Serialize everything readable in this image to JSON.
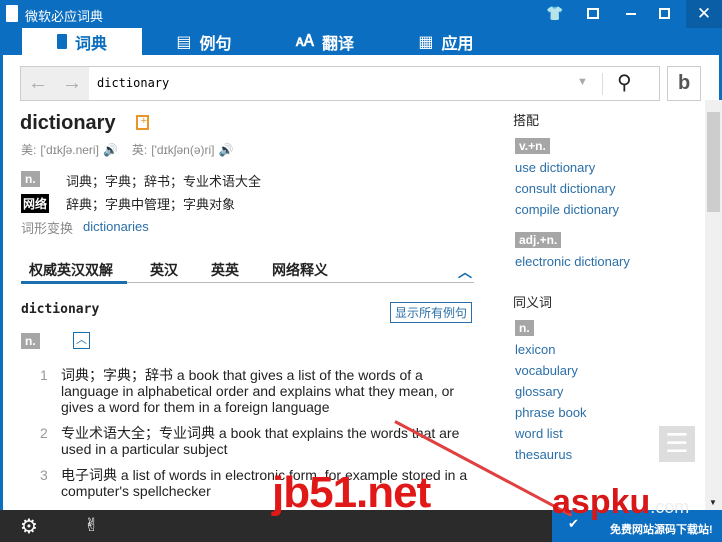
{
  "window": {
    "title": "微软必应词典",
    "controls": [
      "shirt-icon",
      "mini-mode-icon",
      "minimize-icon",
      "maximize-icon",
      "close-icon"
    ]
  },
  "tabs": [
    {
      "label": "词典",
      "icon": "book-icon",
      "active": true
    },
    {
      "label": "例句",
      "icon": "list-icon"
    },
    {
      "label": "翻译",
      "icon": "translate-icon"
    },
    {
      "label": "应用",
      "icon": "apps-icon"
    }
  ],
  "search": {
    "value": "dictionary"
  },
  "entry": {
    "word": "dictionary",
    "us_label": "美:",
    "us_phon": "['dɪkʃə.neri]",
    "uk_label": "英:",
    "uk_phon": "['dɪkʃən(ə)ri]",
    "defs": [
      {
        "pos": "n.",
        "text": "词典；字典；辞书；专业术语大全"
      },
      {
        "pos": "网络",
        "text": "辞典；字典中管理；字典对象"
      }
    ],
    "inflection_label": "词形变换",
    "inflection": "dictionaries"
  },
  "subtabs": [
    "权威英汉双解",
    "英汉",
    "英英",
    "网络释义"
  ],
  "section": {
    "headword": "dictionary",
    "show_all": "显示所有例句",
    "pos": "n.",
    "senses": [
      {
        "num": "1",
        "zh": "词典；字典；辞书",
        "en": "a book that gives a list of the words of a language in alphabetical order and explains what they mean, or gives a word for them in a foreign language"
      },
      {
        "num": "2",
        "zh": "专业术语大全；专业词典",
        "en": "a book that explains the words that are used in a particular subject"
      },
      {
        "num": "3",
        "zh": "电子词典",
        "en": "a list of words in electronic form, for example stored in a computer's spellchecker"
      }
    ]
  },
  "right": {
    "collocations_title": "搭配",
    "groups": [
      {
        "pos": "v.+n.",
        "items": [
          "use dictionary",
          "consult dictionary",
          "compile dictionary"
        ]
      },
      {
        "pos": "adj.+n.",
        "items": [
          "electronic dictionary"
        ]
      }
    ],
    "synonyms_title": "同义词",
    "syn_pos": "n.",
    "synonyms": [
      "lexicon",
      "vocabulary",
      "glossary",
      "phrase book",
      "word list",
      "thesaurus"
    ]
  },
  "watermarks": {
    "jb51": "jb51.net",
    "aspku": "aspku",
    "aspku_com": ".com",
    "aspku_tag": "免费网站源码下载站!"
  }
}
